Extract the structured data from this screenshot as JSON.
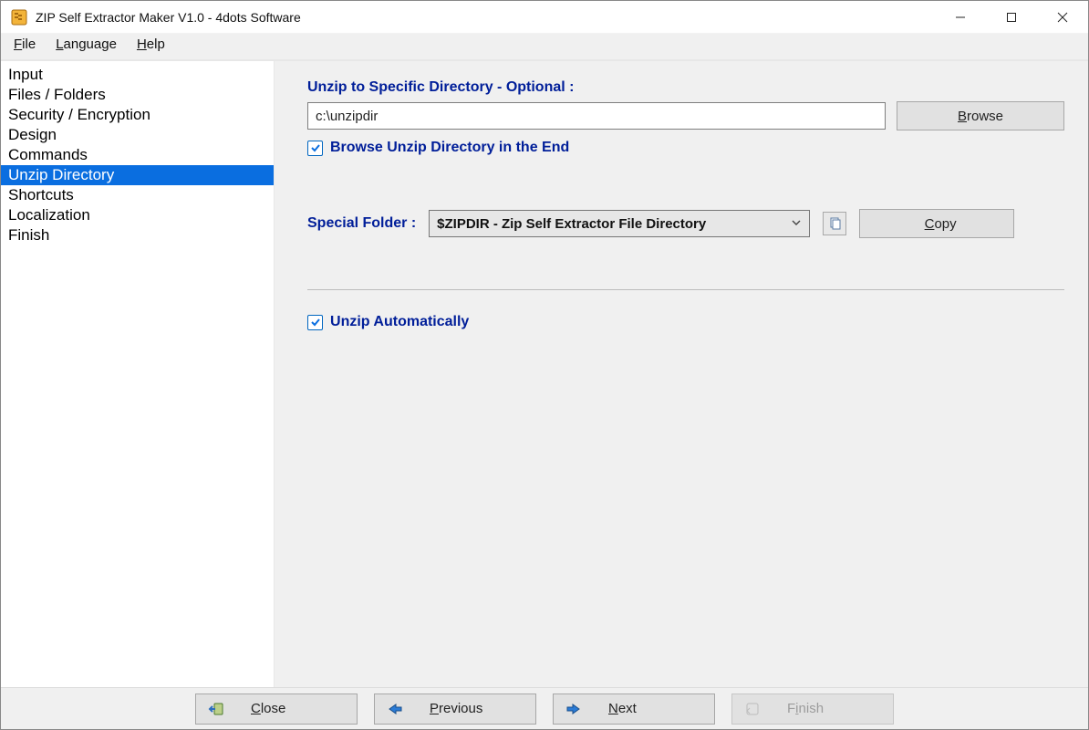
{
  "titlebar": {
    "title": "ZIP Self Extractor Maker V1.0 - 4dots Software"
  },
  "menubar": {
    "file": "File",
    "language": "Language",
    "help": "Help"
  },
  "sidebar": {
    "items": [
      {
        "label": "Input"
      },
      {
        "label": "Files / Folders"
      },
      {
        "label": "Security / Encryption"
      },
      {
        "label": "Design"
      },
      {
        "label": "Commands"
      },
      {
        "label": "Unzip Directory"
      },
      {
        "label": "Shortcuts"
      },
      {
        "label": "Localization"
      },
      {
        "label": "Finish"
      }
    ],
    "selected_index": 5
  },
  "main": {
    "unzip_label": "Unzip to Specific Directory - Optional :",
    "directory_value": "c:\\unzipdir",
    "browse_label": "Browse",
    "browse_checkbox_label": "Browse Unzip Directory in the End",
    "browse_checkbox_checked": true,
    "special_label": "Special Folder :",
    "special_value": "$ZIPDIR - Zip Self Extractor File Directory",
    "copy_label": "Copy",
    "auto_checkbox_label": "Unzip Automatically",
    "auto_checkbox_checked": true
  },
  "footer": {
    "close": "Close",
    "previous": "Previous",
    "next": "Next",
    "finish": "Finish"
  }
}
